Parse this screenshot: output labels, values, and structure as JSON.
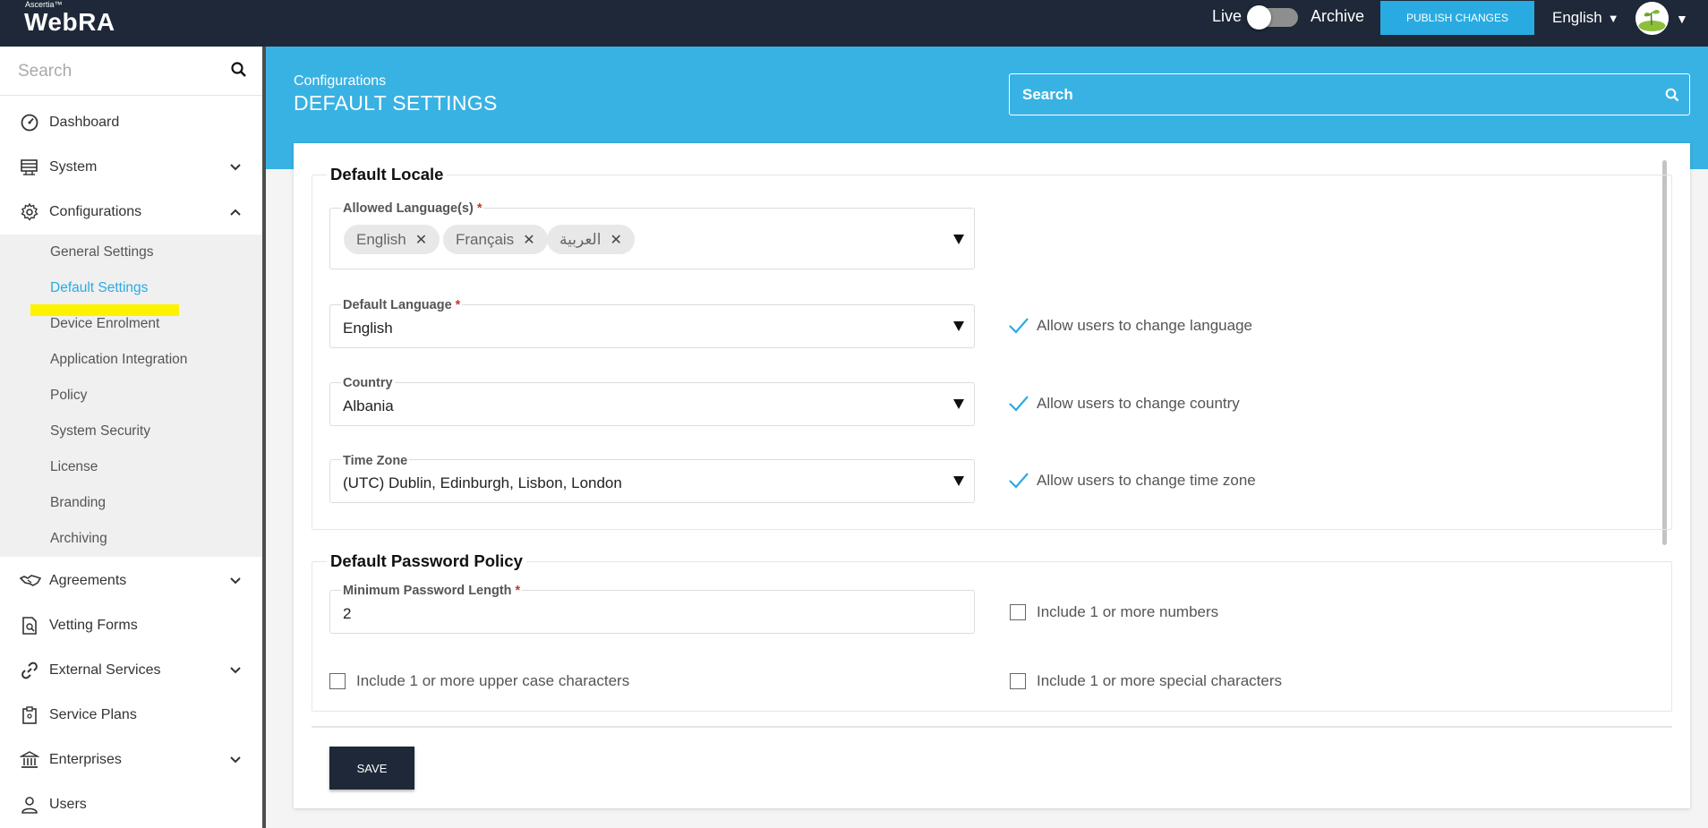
{
  "header": {
    "brand_small": "Ascertia™",
    "brand_name": "WebRA",
    "live_label": "Live",
    "archive_label": "Archive",
    "publish_label": "PUBLISH CHANGES",
    "language": "English",
    "live_toggle_on": false
  },
  "sidebar": {
    "search_placeholder": "Search",
    "items": [
      {
        "label": "Dashboard",
        "icon": "speedometer-icon"
      },
      {
        "label": "System",
        "icon": "server-icon"
      },
      {
        "label": "Configurations",
        "icon": "gear-icon"
      },
      {
        "label": "Agreements",
        "icon": "handshake-icon"
      },
      {
        "label": "Vetting Forms",
        "icon": "document-search-icon"
      },
      {
        "label": "External Services",
        "icon": "link-icon"
      },
      {
        "label": "Service Plans",
        "icon": "clipboard-icon"
      },
      {
        "label": "Enterprises",
        "icon": "bank-icon"
      },
      {
        "label": "Users",
        "icon": "user-icon"
      }
    ],
    "sub_items": [
      {
        "label": "General Settings"
      },
      {
        "label": "Default Settings"
      },
      {
        "label": "Device Enrolment"
      },
      {
        "label": "Application Integration"
      },
      {
        "label": "Policy"
      },
      {
        "label": "System Security"
      },
      {
        "label": "License"
      },
      {
        "label": "Branding"
      },
      {
        "label": "Archiving"
      }
    ],
    "active_sub_item": "Default Settings"
  },
  "main": {
    "breadcrumb": "Configurations",
    "title": "DEFAULT SETTINGS",
    "search_placeholder": "Search"
  },
  "locale": {
    "legend": "Default Locale",
    "allowed_languages_label": "Allowed Language(s)",
    "allowed_languages": [
      "English",
      "Français",
      "العربية"
    ],
    "default_language_label": "Default Language",
    "default_language": "English",
    "allow_change_language": "Allow users to change language",
    "country_label": "Country",
    "country": "Albania",
    "allow_change_country": "Allow users to change country",
    "timezone_label": "Time Zone",
    "timezone": "(UTC) Dublin, Edinburgh, Lisbon, London",
    "allow_change_timezone": "Allow users to change time zone",
    "required_mark": "*"
  },
  "password": {
    "legend": "Default Password Policy",
    "min_length_label": "Minimum Password Length",
    "min_length": "2",
    "include_numbers": "Include 1 or more numbers",
    "include_upper": "Include 1 or more upper case characters",
    "include_special": "Include 1 or more special characters"
  },
  "actions": {
    "save_label": "SAVE"
  },
  "colors": {
    "topbar": "#1e2838",
    "accent": "#29abe2",
    "header_band": "#38b2e3",
    "highlight": "#fff200"
  }
}
